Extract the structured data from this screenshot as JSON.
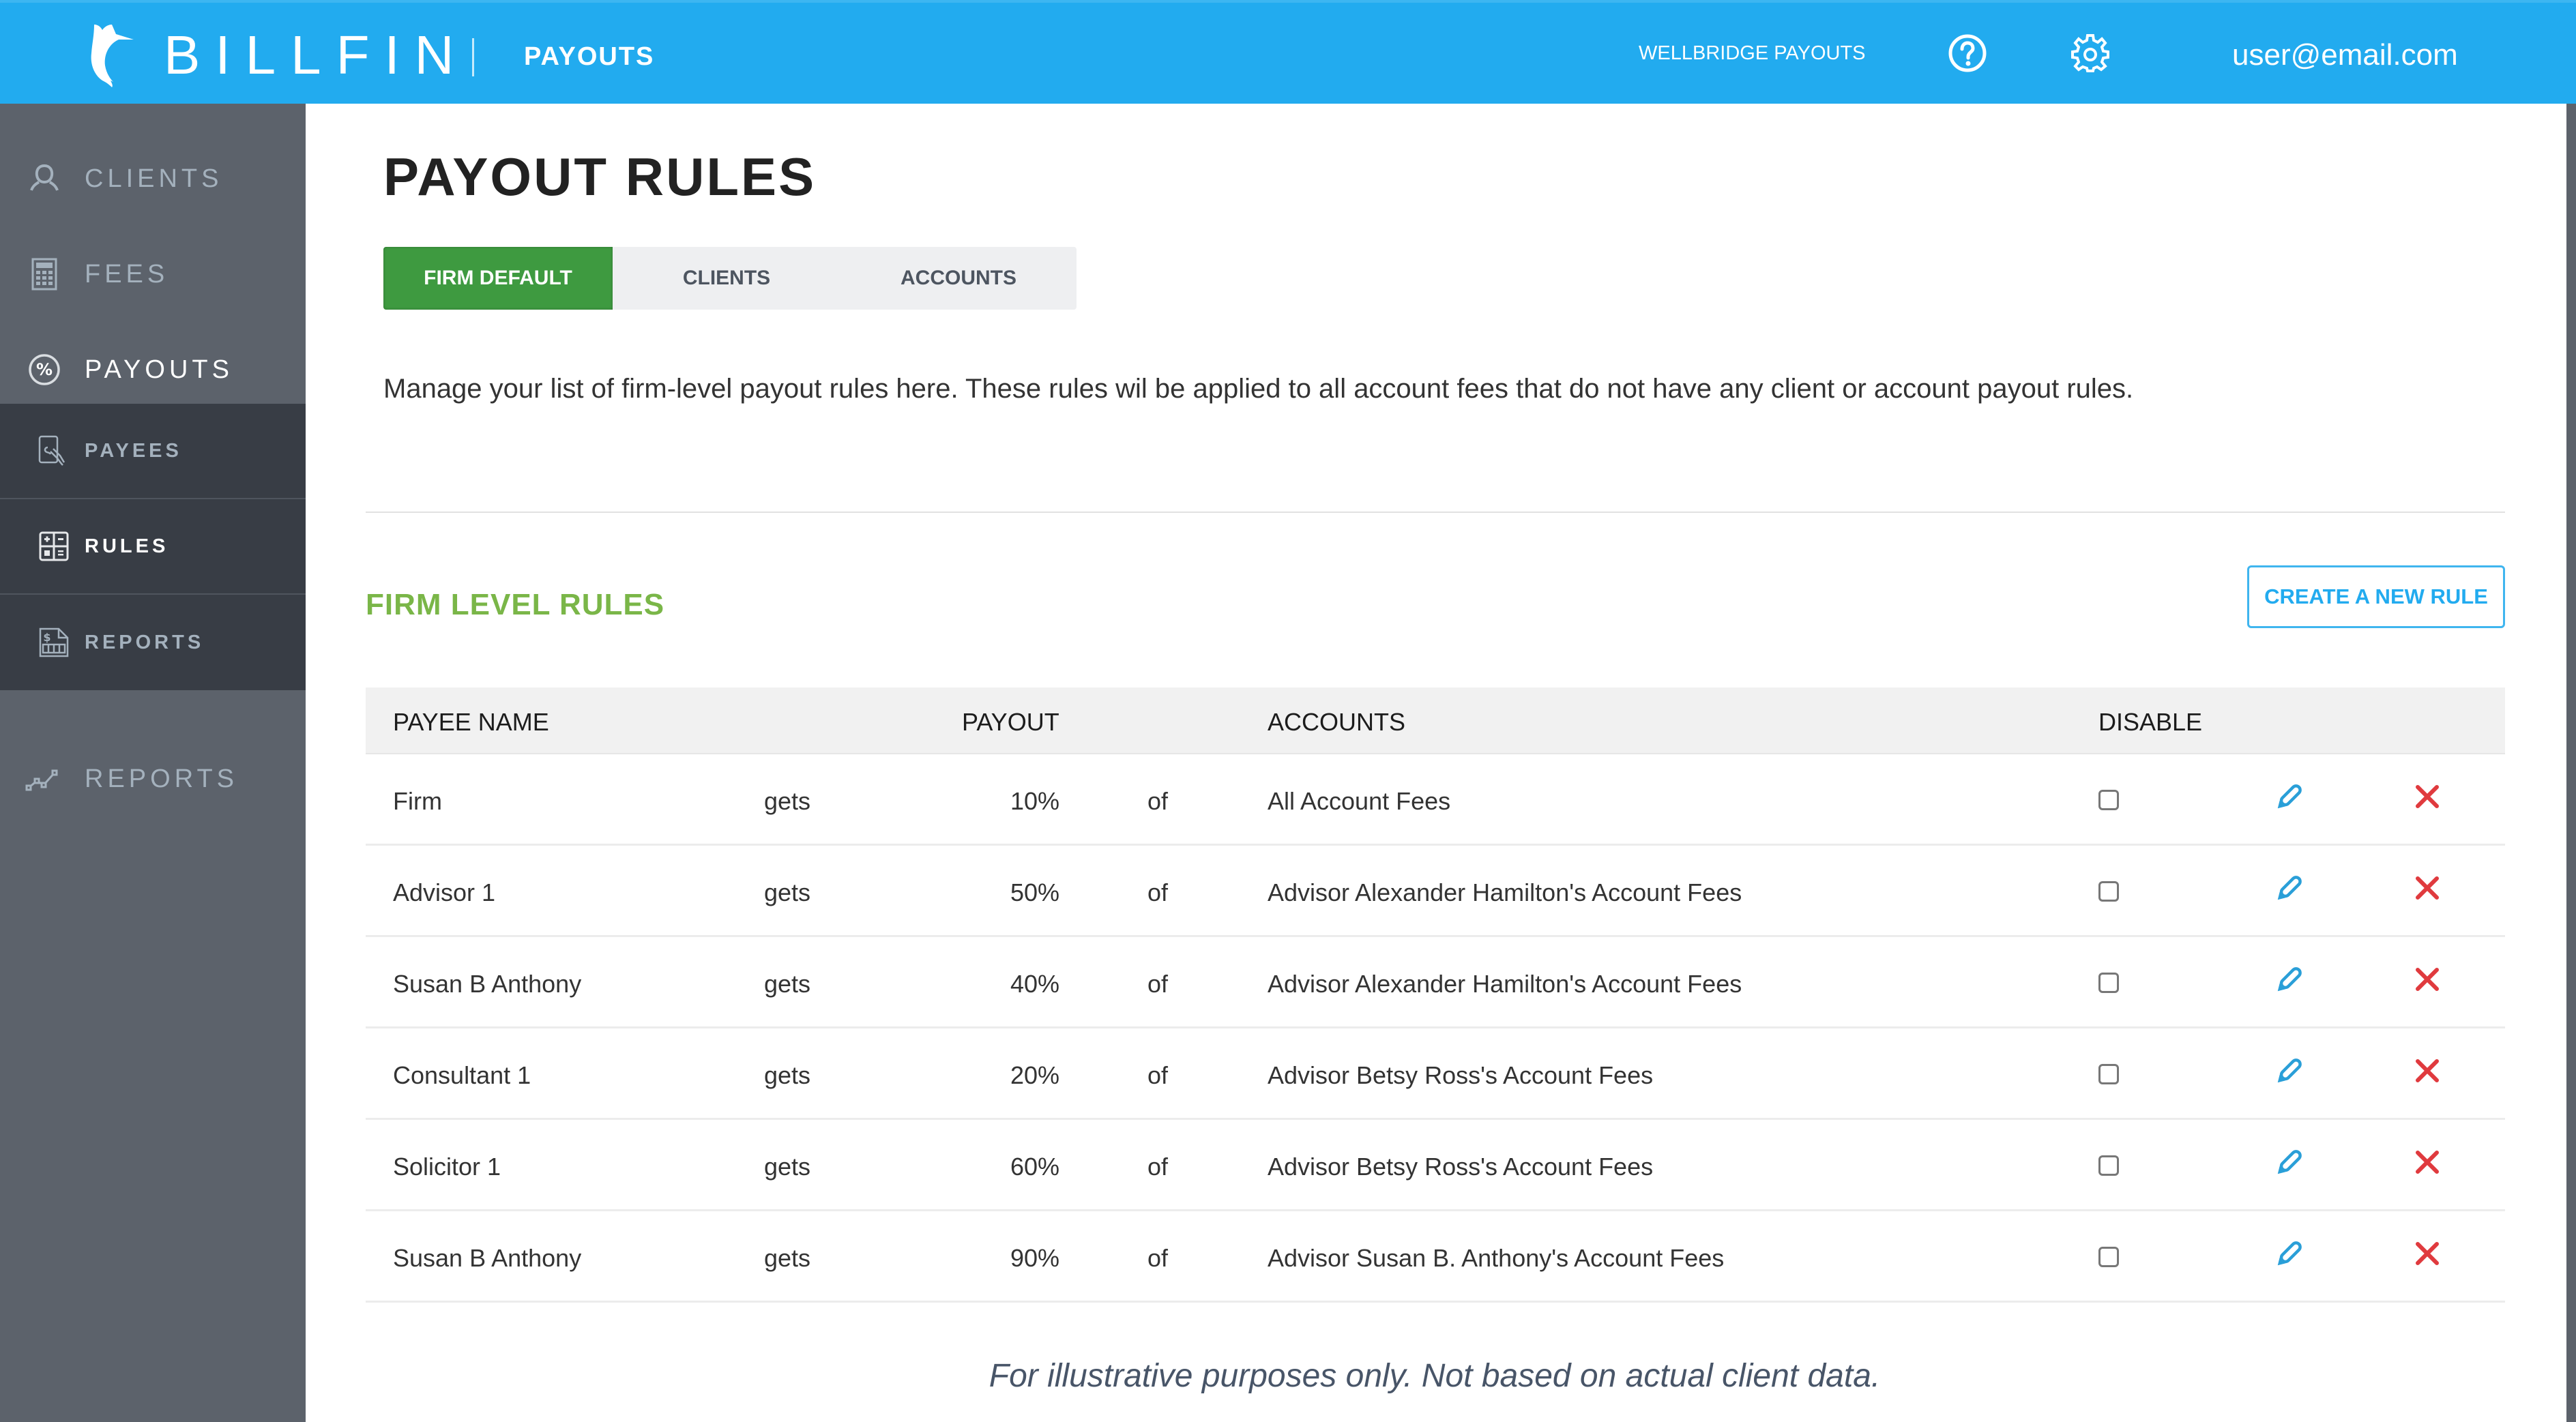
{
  "header": {
    "brand": "BILLFIN",
    "app_name": "PAYOUTS",
    "org_name": "WELLBRIDGE PAYOUTS",
    "help_icon": "help-circle-icon",
    "settings_icon": "gear-icon",
    "user_email": "user@email.com",
    "brand_color": "#22abef"
  },
  "sidebar": {
    "items": [
      {
        "label": "CLIENTS",
        "icon": "user-outline-icon",
        "active": false
      },
      {
        "label": "FEES",
        "icon": "calculator-icon",
        "active": false
      },
      {
        "label": "PAYOUTS",
        "icon": "percent-circle-icon",
        "active": true
      },
      {
        "label": "REPORTS",
        "icon": "line-chart-icon",
        "active": false
      }
    ],
    "subitems": [
      {
        "label": "PAYEES",
        "icon": "hand-document-icon",
        "active": false
      },
      {
        "label": "RULES",
        "icon": "rules-grid-icon",
        "active": true
      },
      {
        "label": "REPORTS",
        "icon": "dollar-report-icon",
        "active": false
      }
    ]
  },
  "main": {
    "title": "PAYOUT RULES",
    "tabs": [
      {
        "label": "FIRM DEFAULT",
        "active": true
      },
      {
        "label": "CLIENTS",
        "active": false
      },
      {
        "label": "ACCOUNTS",
        "active": false
      }
    ],
    "description": "Manage your list of firm-level payout rules here. These rules wil be applied to all account fees that do not have any client or account payout rules.",
    "section_title": "FIRM LEVEL RULES",
    "create_button": "CREATE A NEW RULE",
    "accent_green": "#7ab648",
    "active_tab_color": "#3e9a40",
    "delete_color": "#e03a3e",
    "edit_color": "#2a9fd8"
  },
  "table": {
    "headers": {
      "payee_name": "PAYEE NAME",
      "payout": "PAYOUT",
      "accounts": "ACCOUNTS",
      "disable": "DISABLE"
    },
    "rows": [
      {
        "payee": "Firm",
        "verb": "gets",
        "payout": "10%",
        "prep": "of",
        "accounts": "All Account Fees",
        "disabled": false
      },
      {
        "payee": "Advisor 1",
        "verb": "gets",
        "payout": "50%",
        "prep": "of",
        "accounts": "Advisor Alexander Hamilton's Account Fees",
        "disabled": false
      },
      {
        "payee": "Susan B Anthony",
        "verb": "gets",
        "payout": "40%",
        "prep": "of",
        "accounts": "Advisor Alexander Hamilton's Account Fees",
        "disabled": false
      },
      {
        "payee": "Consultant 1",
        "verb": "gets",
        "payout": "20%",
        "prep": "of",
        "accounts": "Advisor Betsy Ross's Account Fees",
        "disabled": false
      },
      {
        "payee": "Solicitor 1",
        "verb": "gets",
        "payout": "60%",
        "prep": "of",
        "accounts": "Advisor Betsy Ross's Account Fees",
        "disabled": false
      },
      {
        "payee": "Susan B Anthony",
        "verb": "gets",
        "payout": "90%",
        "prep": "of",
        "accounts": "Advisor Susan B. Anthony's Account Fees",
        "disabled": false
      }
    ]
  },
  "footnote": "For illustrative purposes only. Not based on actual client data."
}
